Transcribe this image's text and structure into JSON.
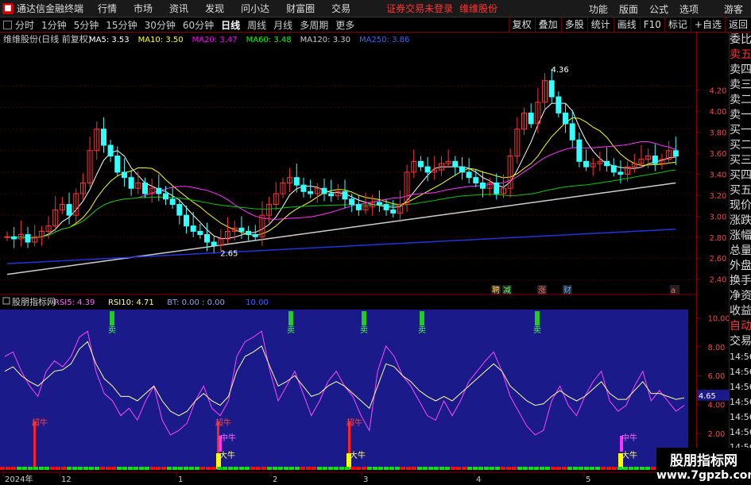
{
  "titlebar": {
    "app_name": "通达信金融终端",
    "menu": [
      "行情",
      "市场",
      "资讯",
      "发现",
      "问小达",
      "财富圈",
      "交易"
    ],
    "login_msg": "证券交易未登录",
    "stock_name": "维维股份",
    "right_menu": [
      "功能",
      "版面",
      "公式",
      "选项"
    ],
    "guest": "游客"
  },
  "toolbar": {
    "periods": [
      "分时",
      "1分钟",
      "5分钟",
      "15分钟",
      "30分钟",
      "60分钟",
      "日线",
      "周线",
      "月线",
      "多周期",
      "更多"
    ],
    "active_period": "日线",
    "buttons": [
      "复权",
      "叠加",
      "多股",
      "统计",
      "画线",
      "F10",
      "标记",
      "+自选",
      "返回"
    ]
  },
  "main_chart": {
    "title": "维维股份(日线 前复权)",
    "ma_labels": [
      {
        "text": "MA5: 3.53",
        "color": "#ffffff"
      },
      {
        "text": "MA10: 3.50",
        "color": "#ffff00"
      },
      {
        "text": "MA20: 3.47",
        "color": "#ff00ff"
      },
      {
        "text": "MA60: 3.48",
        "color": "#00ff00"
      },
      {
        "text": "MA120: 3.30",
        "color": "#cccccc"
      },
      {
        "text": "MA250: 3.86",
        "color": "#3366ff"
      }
    ],
    "y_ticks": [
      "4.20",
      "4.00",
      "3.80",
      "3.60",
      "3.40",
      "3.20",
      "3.00",
      "2.80",
      "2.60",
      "2.40"
    ],
    "ylim": [
      2.3,
      4.55
    ],
    "high_label": "4.36",
    "low_label": "2.65",
    "event_marks": [
      {
        "text": "聘",
        "color": "#ffcc66"
      },
      {
        "text": "减",
        "color": "#66ff66"
      },
      {
        "text": "涨",
        "color": "#ff6666"
      },
      {
        "text": "财",
        "color": "#66aaff"
      },
      {
        "text": "a",
        "color": "#ff6666"
      }
    ]
  },
  "sub_chart": {
    "title": "股朋指标网",
    "labels": [
      {
        "text": "RSI5: 4.39",
        "color": "#ff66ff"
      },
      {
        "text": "RSI10: 4.71",
        "color": "#ffff99"
      },
      {
        "text": "BT: 0.00 : 0.00",
        "color": "#9999ff"
      },
      {
        "text": "10.00",
        "color": "#3366ff"
      }
    ],
    "y_ticks": [
      "10.00",
      "8.00",
      "6.00",
      "4.00",
      "2.00"
    ],
    "current_value": "4.65",
    "signals_sell": "卖",
    "signals_super": "超牛",
    "signals_mid": "中牛",
    "signals_big": "大牛"
  },
  "x_axis": [
    "2024年",
    "12",
    "1",
    "2",
    "3",
    "4",
    "5"
  ],
  "sidebar": {
    "items": [
      "委比",
      "卖五",
      "卖四",
      "卖三",
      "卖二",
      "卖一",
      "买一",
      "买二",
      "买三",
      "买四",
      "买五",
      "现价",
      "涨跌",
      "涨幅",
      "总量",
      "外盘",
      "换手",
      "净资",
      "收益",
      "自动",
      "交易",
      "14:56",
      "14:56",
      "14:56",
      "14:56",
      "14:56",
      "14:56",
      "14:56",
      "14:56",
      "14:56"
    ]
  },
  "watermark": {
    "line1": "股朋指标网",
    "line2": "www.7gpzb.com"
  },
  "chart_data": {
    "type": "candlestick",
    "series": [
      {
        "name": "MA5",
        "values": []
      },
      {
        "name": "MA10",
        "values": []
      },
      {
        "name": "MA20",
        "values": []
      },
      {
        "name": "MA60",
        "values": []
      },
      {
        "name": "MA120",
        "values": []
      },
      {
        "name": "MA250",
        "values": []
      }
    ],
    "closes": [
      2.8,
      2.78,
      2.82,
      2.75,
      2.8,
      2.85,
      2.9,
      3.05,
      3.1,
      3.0,
      3.2,
      3.3,
      3.6,
      3.8,
      3.65,
      3.55,
      3.4,
      3.35,
      3.25,
      3.3,
      3.2,
      3.25,
      3.2,
      3.15,
      3.1,
      3.0,
      2.9,
      2.85,
      2.82,
      2.75,
      2.72,
      2.78,
      2.85,
      2.88,
      2.85,
      2.82,
      2.8,
      3.0,
      3.1,
      3.2,
      3.3,
      3.35,
      3.28,
      3.22,
      3.2,
      3.25,
      3.2,
      3.18,
      3.22,
      3.15,
      3.1,
      3.05,
      3.08,
      3.12,
      3.1,
      3.05,
      3.02,
      3.1,
      3.4,
      3.5,
      3.45,
      3.4,
      3.42,
      3.48,
      3.5,
      3.45,
      3.4,
      3.35,
      3.3,
      3.25,
      3.3,
      3.2,
      3.25,
      3.55,
      3.8,
      3.95,
      3.85,
      4.05,
      4.25,
      4.1,
      3.95,
      3.85,
      3.7,
      3.5,
      3.45,
      3.48,
      3.5,
      3.46,
      3.4,
      3.38,
      3.45,
      3.48,
      3.52,
      3.55,
      3.48,
      3.52,
      3.6,
      3.55
    ],
    "rsi5": [
      7.5,
      7.8,
      6.5,
      5.5,
      4.8,
      6.5,
      7.2,
      6.8,
      7.5,
      8.8,
      9.2,
      6.5,
      5.0,
      4.5,
      3.5,
      4.0,
      3.2,
      4.5,
      5.5,
      3.2,
      2.2,
      2.5,
      3.0,
      4.5,
      5.5,
      4.0,
      3.5,
      4.5,
      7.5,
      8.5,
      8.8,
      9.2,
      6.5,
      4.5,
      5.5,
      6.5,
      5.0,
      3.5,
      4.5,
      5.8,
      6.5,
      5.5,
      4.8,
      3.5,
      2.5,
      6.5,
      8.2,
      7.5,
      6.2,
      5.5,
      4.5,
      3.5,
      3.2,
      4.5,
      3.5,
      4.5,
      5.8,
      6.5,
      7.2,
      7.8,
      6.5,
      4.8,
      3.8,
      2.8,
      2.2,
      2.5,
      4.5,
      5.5,
      4.2,
      3.5,
      4.8,
      5.8,
      6.5,
      4.5,
      3.8,
      4.2,
      5.5,
      6.5,
      4.5,
      5.2,
      4.5,
      3.8,
      4.2
    ],
    "rsi10": [
      6.5,
      6.8,
      6.2,
      5.8,
      5.5,
      6.0,
      6.5,
      6.6,
      7.0,
      8.0,
      8.5,
      7.0,
      6.0,
      5.5,
      4.8,
      4.8,
      4.5,
      5.0,
      5.5,
      4.5,
      3.8,
      3.5,
      3.8,
      4.5,
      5.0,
      4.5,
      4.2,
      4.8,
      6.5,
      7.5,
      7.8,
      8.2,
      6.8,
      5.5,
      5.8,
      6.2,
      5.5,
      4.8,
      5.0,
      5.5,
      5.8,
      5.5,
      5.0,
      4.5,
      4.0,
      5.5,
      7.0,
      6.8,
      6.2,
      5.8,
      5.2,
      4.8,
      4.5,
      4.8,
      4.5,
      5.0,
      5.5,
      6.0,
      6.5,
      7.0,
      6.5,
      5.5,
      5.0,
      4.5,
      4.2,
      4.3,
      4.8,
      5.2,
      4.8,
      4.5,
      4.8,
      5.3,
      5.8,
      5.0,
      4.6,
      4.6,
      5.2,
      5.8,
      5.0,
      5.0,
      4.8,
      4.6,
      4.7
    ]
  }
}
